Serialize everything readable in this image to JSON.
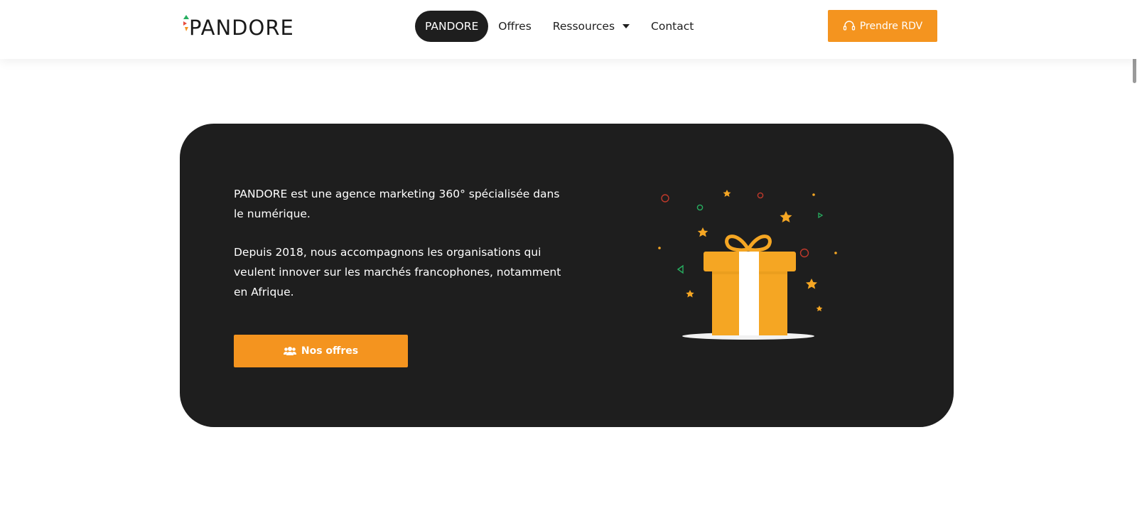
{
  "header": {
    "logo_text": "PANDORE",
    "nav": [
      {
        "label": "PANDORE",
        "active": true
      },
      {
        "label": "Offres",
        "active": false
      },
      {
        "label": "Ressources",
        "active": false,
        "has_dropdown": true
      },
      {
        "label": "Contact",
        "active": false
      }
    ],
    "cta_label": "Prendre RDV",
    "cta_icon": "headset-icon"
  },
  "hero": {
    "paragraph_1": "PANDORE est une agence marketing 360° spécialisée dans le numérique.",
    "paragraph_2": "Depuis 2018, nous accompagnons les organisations qui veulent innover sur les marchés francophones, notamment en Afrique.",
    "button_label": "Nos offres",
    "button_icon": "people-icon",
    "illustration": "gift-box-icon"
  },
  "colors": {
    "accent": "#f4941f",
    "dark": "#1e1e1e",
    "gift": "#f5a623",
    "confetti_red": "#c0392b",
    "confetti_green": "#27ae60"
  }
}
